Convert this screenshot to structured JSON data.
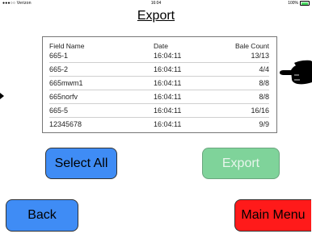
{
  "status_bar": {
    "carrier": "●●●○○ Verizon",
    "time": "16:04",
    "battery": "100%"
  },
  "title": "Export",
  "table": {
    "headers": [
      "Field Name",
      "Date",
      "Bale Count"
    ],
    "rows": [
      [
        "665-1",
        "16:04:11",
        "13/13"
      ],
      [
        "665-2",
        "16:04:11",
        "4/4"
      ],
      [
        "665mwm1",
        "16:04:11",
        "8/8"
      ],
      [
        "665norfv",
        "16:04:11",
        "8/8"
      ],
      [
        "665-5",
        "16:04:11",
        "16/16"
      ],
      [
        "12345678",
        "16:04:11",
        "9/9"
      ]
    ]
  },
  "buttons": {
    "select_all": "Select All",
    "export": "Export",
    "back": "Back",
    "main_menu": "Main Menu"
  },
  "colors": {
    "blue": "#3f8cf5",
    "green_disabled": "#7fd39a",
    "red": "#ff1a1a"
  },
  "icons": {
    "pointer": "pointing-hand-icon",
    "arrow": "left-edge-arrow-icon"
  }
}
